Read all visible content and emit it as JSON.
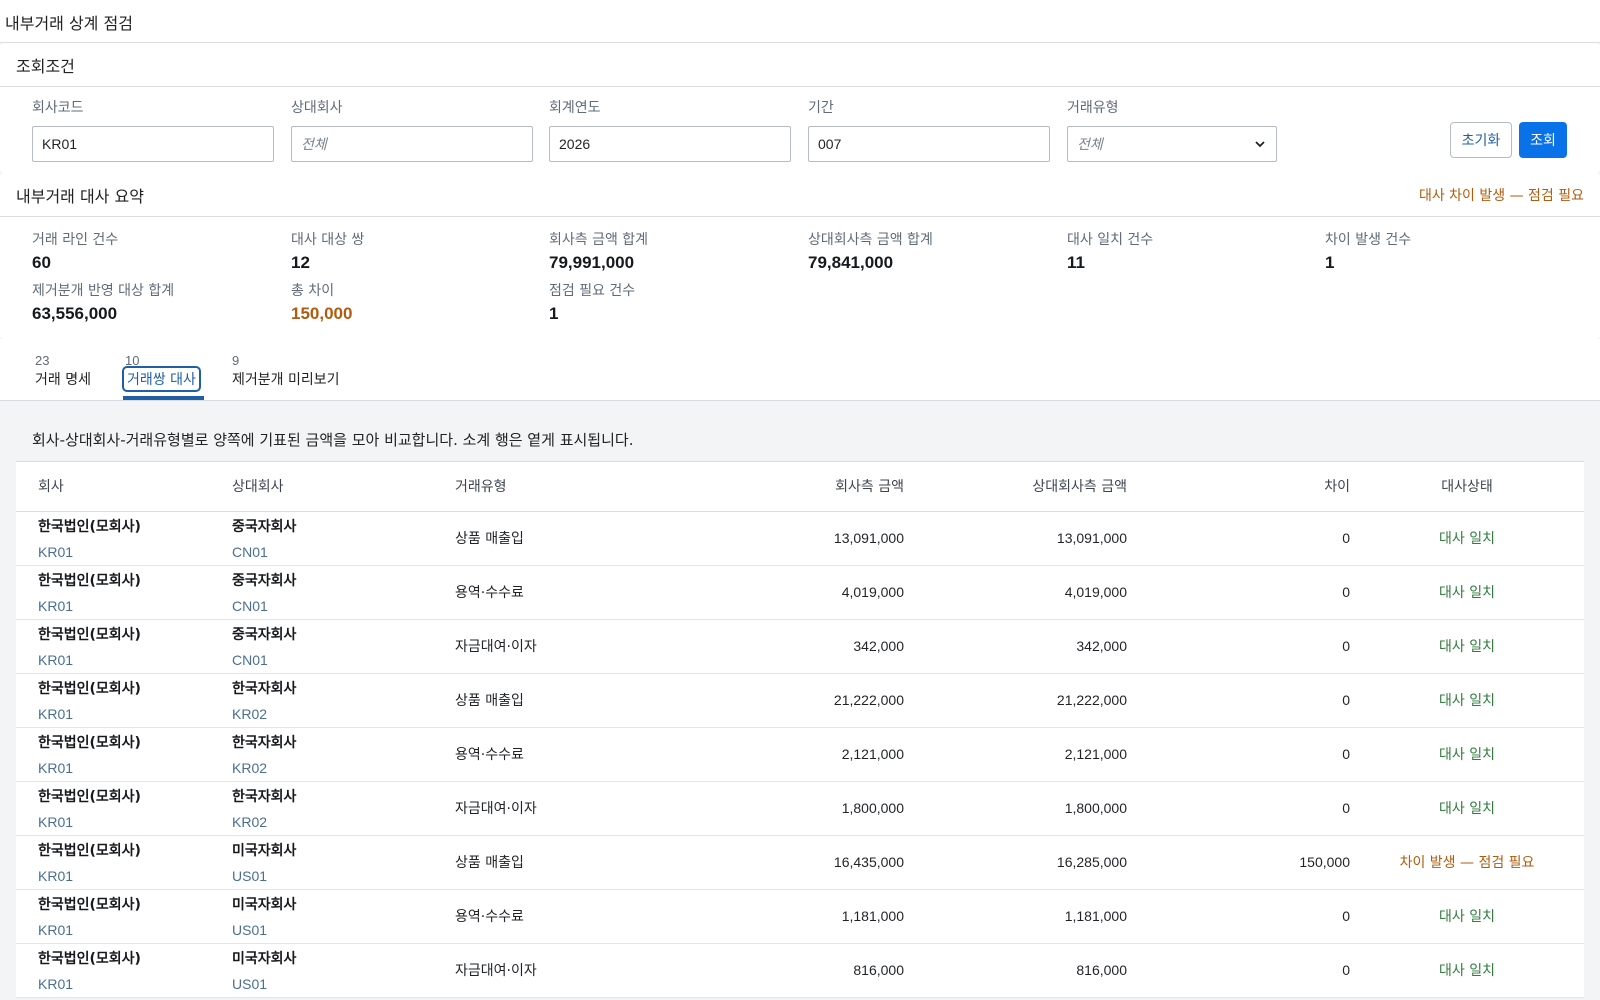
{
  "page": {
    "title": "내부거래 상계 점검"
  },
  "filters": {
    "title": "조회조건",
    "company_code": {
      "label": "회사코드",
      "value": "KR01"
    },
    "counterparty": {
      "label": "상대회사",
      "placeholder": "전체"
    },
    "fiscal_year": {
      "label": "회계연도",
      "value": "2026"
    },
    "period": {
      "label": "기간",
      "value": "007"
    },
    "trade_type": {
      "label": "거래유형",
      "placeholder": "전체"
    },
    "reset_label": "초기화",
    "search_label": "조회"
  },
  "summary": {
    "title": "내부거래 대사 요약",
    "alert": "대사 차이 발생 — 점검 필요",
    "stats": [
      {
        "label": "거래 라인 건수",
        "value": "60"
      },
      {
        "label": "대사 대상 쌍",
        "value": "12"
      },
      {
        "label": "회사측 금액 합계",
        "value": "79,991,000"
      },
      {
        "label": "상대회사측 금액 합계",
        "value": "79,841,000"
      },
      {
        "label": "대사 일치 건수",
        "value": "11"
      },
      {
        "label": "차이 발생 건수",
        "value": "1"
      },
      {
        "label": "제거분개 반영 대상 합계",
        "value": "63,556,000"
      },
      {
        "label": "총 차이",
        "value": "150,000"
      },
      {
        "label": "점검 필요 건수",
        "value": "1"
      }
    ]
  },
  "tabs": [
    {
      "count": "23",
      "label": "거래 명세"
    },
    {
      "count": "10",
      "label": "거래쌍 대사"
    },
    {
      "count": "9",
      "label": "제거분개 미리보기"
    }
  ],
  "description": "회사-상대회사-거래유형별로 양쪽에 기표된 금액을 모아 비교합니다. 소계 행은 옅게 표시됩니다.",
  "table": {
    "headers": [
      "회사",
      "상대회사",
      "거래유형",
      "회사측 금액",
      "상대회사측 금액",
      "차이",
      "대사상태"
    ],
    "rows": [
      {
        "company": "한국법인(모회사)",
        "company_code": "KR01",
        "counterparty": "중국자회사",
        "counterparty_code": "CN01",
        "type": "상품 매출입",
        "company_amount": "13,091,000",
        "counter_amount": "13,091,000",
        "diff": "0",
        "status": "대사 일치"
      },
      {
        "company": "한국법인(모회사)",
        "company_code": "KR01",
        "counterparty": "중국자회사",
        "counterparty_code": "CN01",
        "type": "용역·수수료",
        "company_amount": "4,019,000",
        "counter_amount": "4,019,000",
        "diff": "0",
        "status": "대사 일치"
      },
      {
        "company": "한국법인(모회사)",
        "company_code": "KR01",
        "counterparty": "중국자회사",
        "counterparty_code": "CN01",
        "type": "자금대여·이자",
        "company_amount": "342,000",
        "counter_amount": "342,000",
        "diff": "0",
        "status": "대사 일치"
      },
      {
        "company": "한국법인(모회사)",
        "company_code": "KR01",
        "counterparty": "한국자회사",
        "counterparty_code": "KR02",
        "type": "상품 매출입",
        "company_amount": "21,222,000",
        "counter_amount": "21,222,000",
        "diff": "0",
        "status": "대사 일치"
      },
      {
        "company": "한국법인(모회사)",
        "company_code": "KR01",
        "counterparty": "한국자회사",
        "counterparty_code": "KR02",
        "type": "용역·수수료",
        "company_amount": "2,121,000",
        "counter_amount": "2,121,000",
        "diff": "0",
        "status": "대사 일치"
      },
      {
        "company": "한국법인(모회사)",
        "company_code": "KR01",
        "counterparty": "한국자회사",
        "counterparty_code": "KR02",
        "type": "자금대여·이자",
        "company_amount": "1,800,000",
        "counter_amount": "1,800,000",
        "diff": "0",
        "status": "대사 일치"
      },
      {
        "company": "한국법인(모회사)",
        "company_code": "KR01",
        "counterparty": "미국자회사",
        "counterparty_code": "US01",
        "type": "상품 매출입",
        "company_amount": "16,435,000",
        "counter_amount": "16,285,000",
        "diff": "150,000",
        "status": "차이 발생 — 점검 필요"
      },
      {
        "company": "한국법인(모회사)",
        "company_code": "KR01",
        "counterparty": "미국자회사",
        "counterparty_code": "US01",
        "type": "용역·수수료",
        "company_amount": "1,181,000",
        "counter_amount": "1,181,000",
        "diff": "0",
        "status": "대사 일치"
      },
      {
        "company": "한국법인(모회사)",
        "company_code": "KR01",
        "counterparty": "미국자회사",
        "counterparty_code": "US01",
        "type": "자금대여·이자",
        "company_amount": "816,000",
        "counter_amount": "816,000",
        "diff": "0",
        "status": "대사 일치"
      }
    ]
  },
  "colors": {
    "accent": "#0a72e8",
    "warning": "#b15b0c",
    "success": "#2f7d3c"
  }
}
